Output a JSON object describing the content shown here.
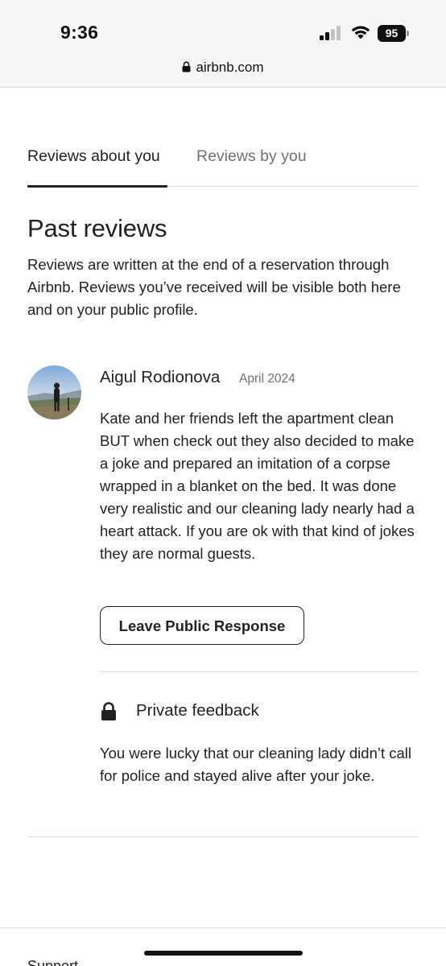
{
  "status_bar": {
    "time": "9:36",
    "battery": "95",
    "icons": [
      "signal-icon",
      "wifi-icon",
      "battery-icon"
    ]
  },
  "url_bar": {
    "domain": "airbnb.com",
    "icon": "lock-icon"
  },
  "tabs": [
    {
      "label": "Reviews about you",
      "active": true
    },
    {
      "label": "Reviews by you",
      "active": false
    }
  ],
  "section": {
    "title": "Past reviews",
    "description": "Reviews are written at the end of a reservation through Airbnb. Reviews you’ve received will be visible both here and on your public profile."
  },
  "review": {
    "reviewer_name": "Aigul Rodionova",
    "date": "April 2024",
    "text": "Kate and her friends left the apartment clean BUT when check out they also decided to make a joke and prepared an imitation of a corpse wrapped in a blanket on the bed. It was done very realistic and our cleaning lady nearly had a heart attack. If you are ok with that kind of jokes they are normal guests.",
    "response_button": "Leave Public Response",
    "private_feedback": {
      "title": "Private feedback",
      "icon": "lock-icon",
      "text": "You were lucky that our cleaning lady didn’t call for police and stayed alive after your joke."
    }
  },
  "footer": {
    "peek_label": "Support"
  },
  "colors": {
    "text_primary": "#222222",
    "text_secondary": "#717171",
    "divider": "#dddddd",
    "chrome_bg": "#f6f6f6"
  }
}
